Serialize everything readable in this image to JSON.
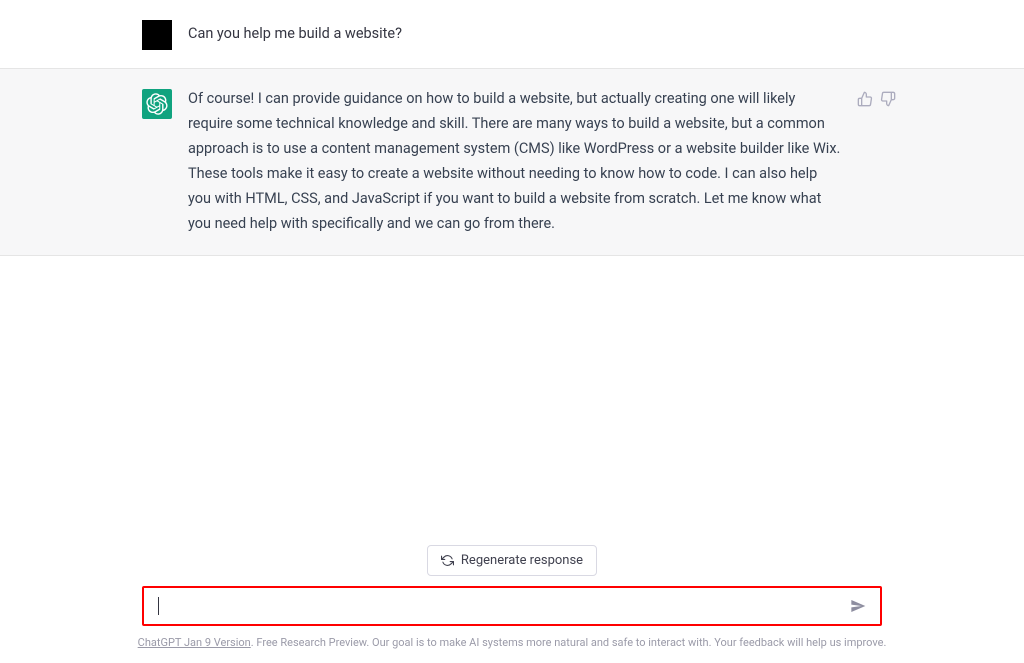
{
  "conversation": {
    "user_message": "Can you help me build a website?",
    "assistant_message": "Of course! I can provide guidance on how to build a website, but actually creating one will likely require some technical knowledge and skill. There are many ways to build a website, but a common approach is to use a content management system (CMS) like WordPress or a website builder like Wix. These tools make it easy to create a website without needing to know how to code. I can also help you with HTML, CSS, and JavaScript if you want to build a website from scratch. Let me know what you need help with specifically and we can go from there."
  },
  "controls": {
    "regenerate_label": "Regenerate response"
  },
  "input": {
    "value": "",
    "placeholder": ""
  },
  "footer": {
    "link_text": "ChatGPT Jan 9 Version",
    "rest_text": ". Free Research Preview. Our goal is to make AI systems more natural and safe to interact with. Your feedback will help us improve."
  }
}
